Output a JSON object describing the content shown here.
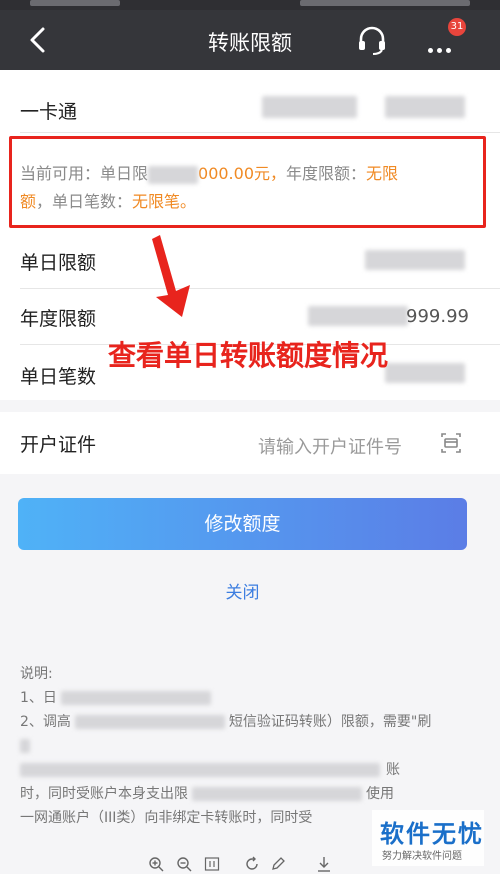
{
  "header": {
    "title": "转账限额",
    "notification_count": "31"
  },
  "account": {
    "label": "一卡通"
  },
  "limit_tip": {
    "prefix": "当前可用：单日限",
    "daily_amount_visible": "000.00元，",
    "annual_label": "年度限额：",
    "annual_value": "无限",
    "annual_value_tail": "额",
    "count_label": "，单日笔数：",
    "count_value": "无限笔。"
  },
  "rows": {
    "daily_limit_label": "单日限额",
    "annual_limit_label": "年度限额",
    "annual_limit_value": "999.99",
    "daily_count_label": "单日笔数"
  },
  "annotation": {
    "text": "查看单日转账额度情况"
  },
  "id_field": {
    "label": "开户证件",
    "placeholder": "请输入开户证件号"
  },
  "buttons": {
    "modify": "修改额度",
    "close": "关闭"
  },
  "notes": {
    "heading": "说明:",
    "line1": "1、日",
    "line2a": "2、调高",
    "line2b": "短信验证码转账）限额，需要\"刷",
    "line3": "账",
    "line4a": "时，同时受账户本身支出限",
    "line4b": "使用",
    "line5": "一网通账户（III类）向非绑定卡转账时，同时受"
  },
  "watermark": {
    "main": "软件无忧",
    "sub": "努力解决软件问题"
  },
  "colors": {
    "navbar": "#35363a",
    "accent_orange": "#f08a24",
    "annotation_red": "#e8241d",
    "button_gradient_start": "#4fb2f7",
    "button_gradient_end": "#5b7de6",
    "link_blue": "#3d7ee0"
  }
}
